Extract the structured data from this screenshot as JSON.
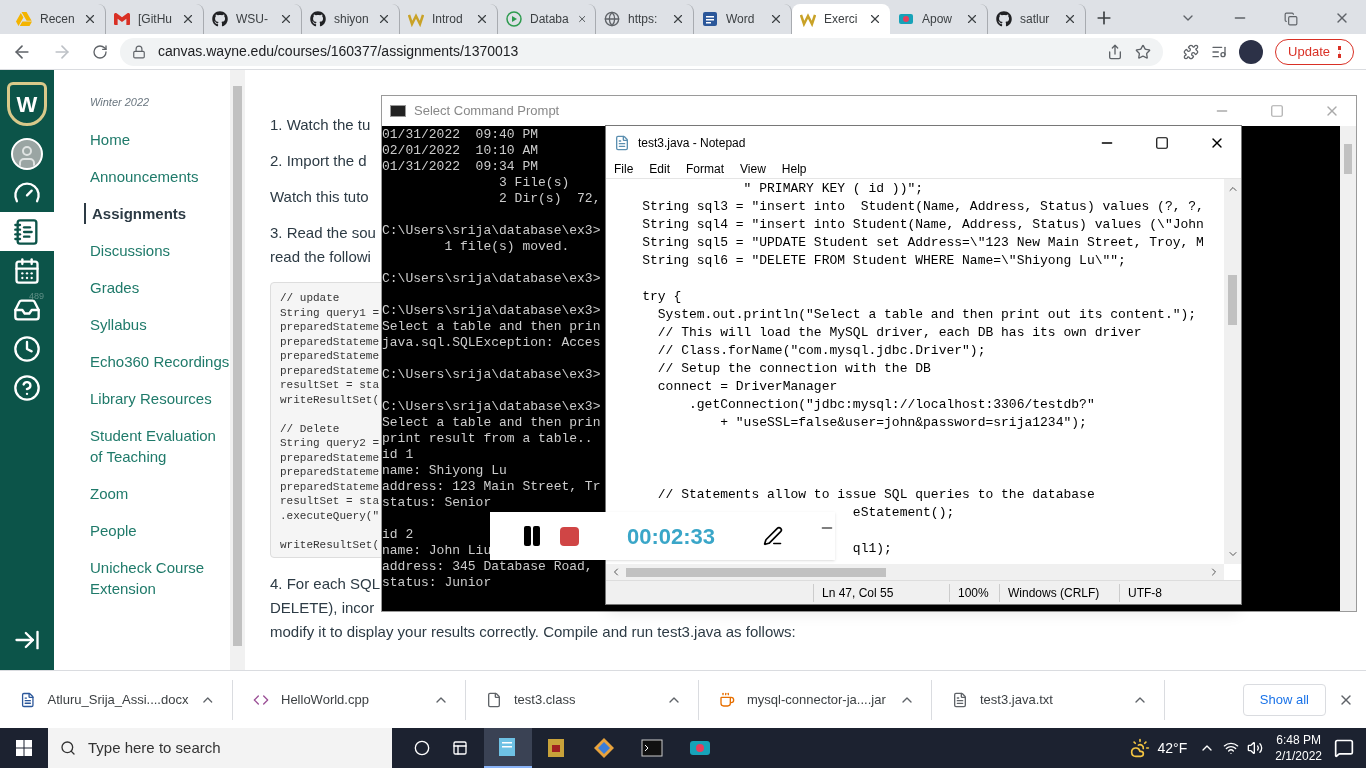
{
  "browser": {
    "tabs": [
      {
        "title": "Recen",
        "kind": "drive",
        "selected": false
      },
      {
        "title": "[GitHu",
        "kind": "mail",
        "selected": false
      },
      {
        "title": "WSU-",
        "kind": "cat",
        "selected": false
      },
      {
        "title": "shiyon",
        "kind": "cat",
        "selected": false
      },
      {
        "title": "Introd",
        "kind": "zigzag",
        "selected": false
      },
      {
        "title": "Databa",
        "kind": "play",
        "selected": false
      },
      {
        "title": "https:",
        "kind": "globe",
        "selected": false
      },
      {
        "title": "Word",
        "kind": "word",
        "selected": false
      },
      {
        "title": "Exerci",
        "kind": "zigzag",
        "selected": true
      },
      {
        "title": "Apow",
        "kind": "recorder",
        "selected": false
      },
      {
        "title": "satlur",
        "kind": "cat",
        "selected": false
      }
    ],
    "url": "canvas.wayne.edu/courses/160377/assignments/1370013",
    "update_button": "Update"
  },
  "global_nav": {
    "logo_letter": "W",
    "items": [
      {
        "kind": "account",
        "selected": false
      },
      {
        "kind": "dashboard",
        "selected": false
      },
      {
        "kind": "courses",
        "selected": true
      },
      {
        "kind": "calendar",
        "selected": false
      },
      {
        "kind": "inbox",
        "selected": false,
        "badge": "489"
      },
      {
        "kind": "history",
        "selected": false
      },
      {
        "kind": "help",
        "selected": false
      }
    ]
  },
  "course_nav": {
    "term": "Winter 2022",
    "items": [
      {
        "label": "Home",
        "selected": false
      },
      {
        "label": "Announcements",
        "selected": false
      },
      {
        "label": "Assignments",
        "selected": true
      },
      {
        "label": "Discussions",
        "selected": false
      },
      {
        "label": "Grades",
        "selected": false
      },
      {
        "label": "Syllabus",
        "selected": false
      },
      {
        "label": "Echo360 Recordings",
        "selected": false
      },
      {
        "label": "Library Resources",
        "selected": false
      },
      {
        "label": "Student Evaluation of Teaching",
        "selected": false
      },
      {
        "label": "Zoom",
        "selected": false
      },
      {
        "label": "People",
        "selected": false
      },
      {
        "label": "Unicheck Course Extension",
        "selected": false
      }
    ]
  },
  "page": {
    "paragraphs_before": [
      {
        "text": "1. Watch the tu",
        "kind": "gap"
      },
      {
        "text": "2.  Import the d",
        "kind": "gap"
      },
      {
        "text": "Watch this tuto",
        "kind": "gap"
      },
      {
        "text": "3.  Read the sou",
        "kind": "tight"
      },
      {
        "text": "read the followi",
        "kind": "gap"
      }
    ],
    "code": [
      {
        "kind": "text",
        "text": "// update"
      },
      {
        "kind": "text",
        "text": "String query1 ="
      },
      {
        "kind": "text",
        "text": "preparedStateme"
      },
      {
        "kind": "text",
        "text": "preparedStateme"
      },
      {
        "kind": "text",
        "text": "preparedStateme"
      },
      {
        "kind": "text",
        "text": "preparedStateme"
      },
      {
        "kind": "text",
        "text": "resultSet = sta"
      },
      {
        "kind": "text",
        "text": "writeResultSet("
      },
      {
        "kind": "blank"
      },
      {
        "kind": "text",
        "text": "// Delete"
      },
      {
        "kind": "text",
        "text": "String query2 ="
      },
      {
        "kind": "text",
        "text": "preparedStateme"
      },
      {
        "kind": "text",
        "text": "preparedStateme"
      },
      {
        "kind": "text",
        "text": "preparedStateme"
      },
      {
        "kind": "text",
        "text": "resultSet = sta"
      },
      {
        "kind": "text",
        "text": ".executeQuery(\""
      },
      {
        "kind": "blank"
      },
      {
        "kind": "text",
        "text": "writeResultSet("
      }
    ],
    "paragraphs_after": [
      "4. For each SQL",
      "DELETE),  incor",
      "modify it to display your results correctly. Compile and run test3.java as follows:"
    ]
  },
  "command_prompt": {
    "title": "Select Command Prompt",
    "lines": [
      {
        "kind": "text",
        "text": "01/31/2022  09:40 PM"
      },
      {
        "kind": "text",
        "text": "02/01/2022  10:10 AM"
      },
      {
        "kind": "text",
        "text": "01/31/2022  09:34 PM"
      },
      {
        "kind": "text",
        "text": "               3 File(s)"
      },
      {
        "kind": "text",
        "text": "               2 Dir(s)  72,"
      },
      {
        "kind": "blank"
      },
      {
        "kind": "text",
        "text": "C:\\Users\\srija\\database\\ex3>"
      },
      {
        "kind": "text",
        "text": "        1 file(s) moved."
      },
      {
        "kind": "blank"
      },
      {
        "kind": "text",
        "text": "C:\\Users\\srija\\database\\ex3>"
      },
      {
        "kind": "blank"
      },
      {
        "kind": "text",
        "text": "C:\\Users\\srija\\database\\ex3>"
      },
      {
        "kind": "text",
        "text": "Select a table and then prin"
      },
      {
        "kind": "text",
        "text": "java.sql.SQLException: Acces"
      },
      {
        "kind": "blank"
      },
      {
        "kind": "text",
        "text": "C:\\Users\\srija\\database\\ex3>"
      },
      {
        "kind": "blank"
      },
      {
        "kind": "text",
        "text": "C:\\Users\\srija\\database\\ex3>"
      },
      {
        "kind": "text",
        "text": "Select a table and then prin"
      },
      {
        "kind": "text",
        "text": "print result from a table.."
      },
      {
        "kind": "text",
        "text": "id 1"
      },
      {
        "kind": "text",
        "text": "name: Shiyong Lu"
      },
      {
        "kind": "text",
        "text": "address: 123 Main Street, Tr"
      },
      {
        "kind": "text",
        "text": "status: Senior"
      },
      {
        "kind": "blank"
      },
      {
        "kind": "text",
        "text": "id 2"
      },
      {
        "kind": "text",
        "text": "name: John Liu"
      },
      {
        "kind": "text",
        "text": "address: 345 Database Road,"
      },
      {
        "kind": "text",
        "text": "status: Junior"
      }
    ]
  },
  "notepad": {
    "title": "test3.java - Notepad",
    "menu": [
      "File",
      "Edit",
      "Format",
      "View",
      "Help"
    ],
    "lines": [
      {
        "kind": "text",
        "text": "                 \" PRIMARY KEY ( id ))\";"
      },
      {
        "kind": "text",
        "text": "    String sql3 = \"insert into  Student(Name, Address, Status) values (?, ?,"
      },
      {
        "kind": "text",
        "text": "    String sql4 = \"insert into Student(Name, Address, Status) values (\\\"John"
      },
      {
        "kind": "text",
        "text": "    String sql5 = \"UPDATE Student set Address=\\\"123 New Main Street, Troy, M"
      },
      {
        "kind": "text",
        "text": "    String sql6 = \"DELETE FROM Student WHERE Name=\\\"Shiyong Lu\\\"\";"
      },
      {
        "kind": "blank"
      },
      {
        "kind": "text",
        "text": "    try {"
      },
      {
        "kind": "text",
        "text": "      System.out.println(\"Select a table and then print out its content.\");"
      },
      {
        "kind": "text",
        "text": "      // This will load the MySQL driver, each DB has its own driver"
      },
      {
        "kind": "text",
        "text": "      // Class.forName(\"com.mysql.jdbc.Driver\");"
      },
      {
        "kind": "text",
        "text": "      // Setup the connection with the DB"
      },
      {
        "kind": "text",
        "text": "      connect = DriverManager"
      },
      {
        "kind": "text",
        "text": "          .getConnection(\"jdbc:mysql://localhost:3306/testdb?\""
      },
      {
        "kind": "text",
        "text": "              + \"useSSL=false&user=john&password=srija1234\");"
      },
      {
        "kind": "blank"
      },
      {
        "kind": "blank"
      },
      {
        "kind": "blank"
      },
      {
        "kind": "text",
        "text": "      // Statements allow to issue SQL queries to the database"
      },
      {
        "kind": "text",
        "text": "                               eStatement();"
      },
      {
        "kind": "blank"
      },
      {
        "kind": "text",
        "text": "                               ql1);"
      }
    ],
    "status": {
      "position": "Ln 47, Col 55",
      "zoom": "100%",
      "line_ending": "Windows (CRLF)",
      "encoding": "UTF-8"
    }
  },
  "recorder": {
    "time": "00:02:33"
  },
  "downloads": {
    "items": [
      {
        "name": "Atluru_Srija_Assi....docx",
        "kind": "word"
      },
      {
        "name": "HelloWorld.cpp",
        "kind": "code"
      },
      {
        "name": "test3.class",
        "kind": "file"
      },
      {
        "name": "mysql-connector-ja....jar",
        "kind": "java"
      },
      {
        "name": "test3.java.txt",
        "kind": "text"
      }
    ],
    "show_all": "Show all"
  },
  "taskbar": {
    "search_placeholder": "Type here to search",
    "apps": [
      {
        "kind": "notepad",
        "selected": true
      },
      {
        "kind": "archive",
        "selected": false
      },
      {
        "kind": "diamond",
        "selected": false
      },
      {
        "kind": "terminal",
        "selected": false
      },
      {
        "kind": "camera",
        "selected": false
      }
    ],
    "temperature": "42°F",
    "time": "6:48 PM",
    "date": "2/1/2022"
  }
}
